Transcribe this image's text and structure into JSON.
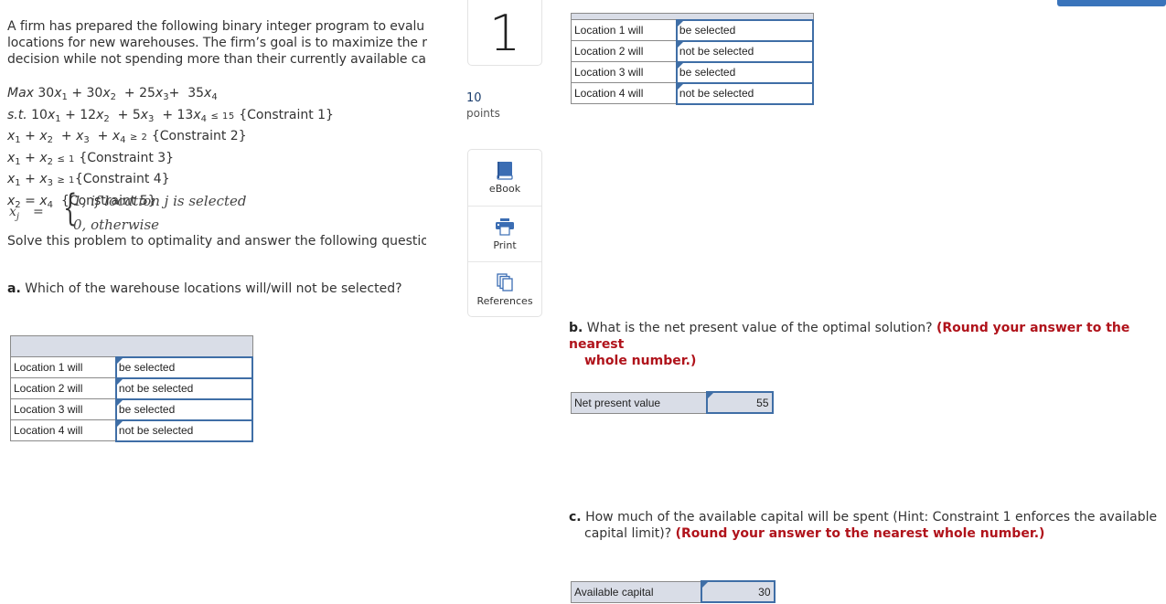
{
  "intro": {
    "lines": [
      "A firm has prepared the following binary integer program to evalu",
      "locations for new warehouses. The firm’s goal is to maximize the r",
      "decision while not spending more than their currently available ca"
    ]
  },
  "model": {
    "objective": {
      "prefix": "Max",
      "terms": "30x1 + 30x2 + 25x3 + 35x4"
    },
    "constraints": [
      {
        "prefix": "s.t.",
        "expr": "10x1 + 12x2 + 5x3 + 13x4 ≤ 15",
        "label": "{Constraint 1}"
      },
      {
        "expr": "x1 + x2 + x3 + x4 ≥ 2",
        "label": "{Constraint 2}"
      },
      {
        "expr": "x1 + x2 ≤ 1",
        "label": "{Constraint 3}"
      },
      {
        "expr": "x1 + x3 ≥ 1",
        "label": "{Constraint 4}"
      },
      {
        "expr": "x2 = x4",
        "label": "{Constraint 5}"
      }
    ],
    "piecewise": {
      "var": "x",
      "sub": "j",
      "case1": "1, if location j is selected",
      "case2": "0, otherwise"
    }
  },
  "solve_text": "Solve this problem to optimality and answer the following questio",
  "question_a": {
    "prefix": "a.",
    "text": "Which of the warehouse locations will/will not be selected?",
    "rows": [
      {
        "label": "Location 1 will",
        "value": "be selected"
      },
      {
        "label": "Location 2 will",
        "value": "not be selected"
      },
      {
        "label": "Location 3 will",
        "value": "be selected"
      },
      {
        "label": "Location 4 will",
        "value": "not be selected"
      }
    ]
  },
  "question_card": {
    "number": "1",
    "points_value": "10",
    "points_label": "points"
  },
  "tools": [
    {
      "label": "eBook",
      "icon": "book-icon"
    },
    {
      "label": "Print",
      "icon": "printer-icon"
    },
    {
      "label": "References",
      "icon": "references-icon"
    }
  ],
  "question_b": {
    "prefix": "b.",
    "text": "What is the net present value of the optimal solution?",
    "hint": "(Round your answer to the nearest",
    "hint2": "whole number.)",
    "field_label": "Net present value",
    "field_value": "55"
  },
  "question_c": {
    "prefix": "c.",
    "text": "How much of the available capital will be spent (Hint: Constraint 1 enforces the available",
    "text2": "capital limit)?",
    "hint": "(Round your answer to the nearest whole number.)",
    "field_label": "Available capital",
    "field_value": "30"
  },
  "colors": {
    "accent": "#3a74bb",
    "field_border": "#3f6ea6",
    "header_bg": "#d9dde7",
    "hint_red": "#b0131b"
  }
}
